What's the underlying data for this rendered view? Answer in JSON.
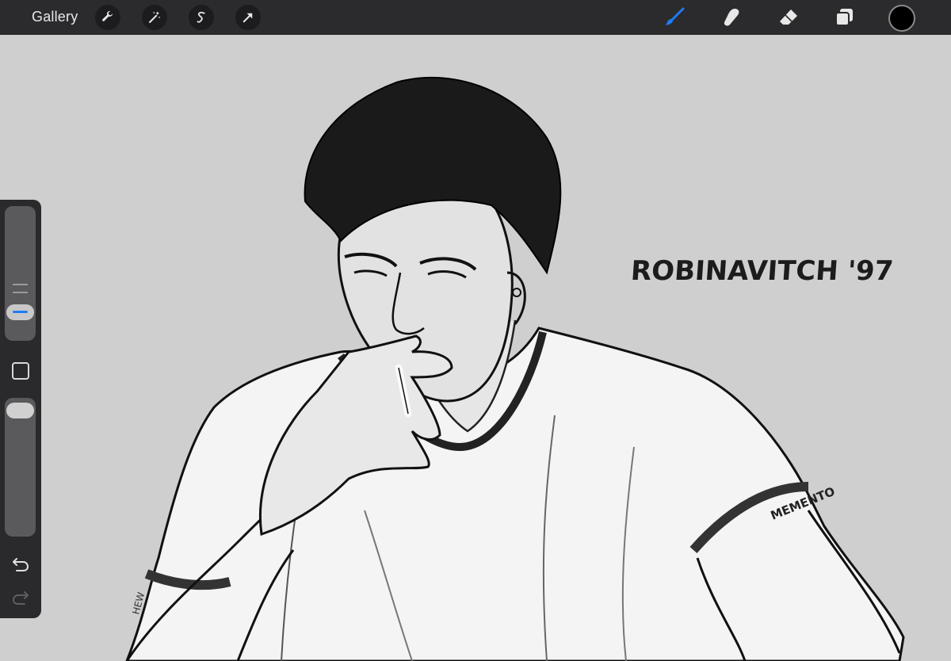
{
  "toolbar": {
    "gallery_label": "Gallery",
    "left_tools": [
      {
        "icon": "wrench-icon"
      },
      {
        "icon": "magic-wand-icon"
      },
      {
        "icon": "selection-icon"
      },
      {
        "icon": "transform-arrow-icon"
      }
    ],
    "right_tools": [
      {
        "icon": "brush-icon",
        "active": true
      },
      {
        "icon": "smudge-icon"
      },
      {
        "icon": "eraser-icon"
      },
      {
        "icon": "layers-icon"
      }
    ],
    "current_color": "#000000",
    "accent_color": "#1e7cf2"
  },
  "sidebar": {
    "brush_size_level": 0.25,
    "brush_opacity_level": 1.0,
    "undo_icon": "undo-icon",
    "redo_icon": "redo-icon"
  },
  "canvas": {
    "background_color": "#cfcfcf",
    "signature_text": "ROBINAVITCH '97"
  }
}
